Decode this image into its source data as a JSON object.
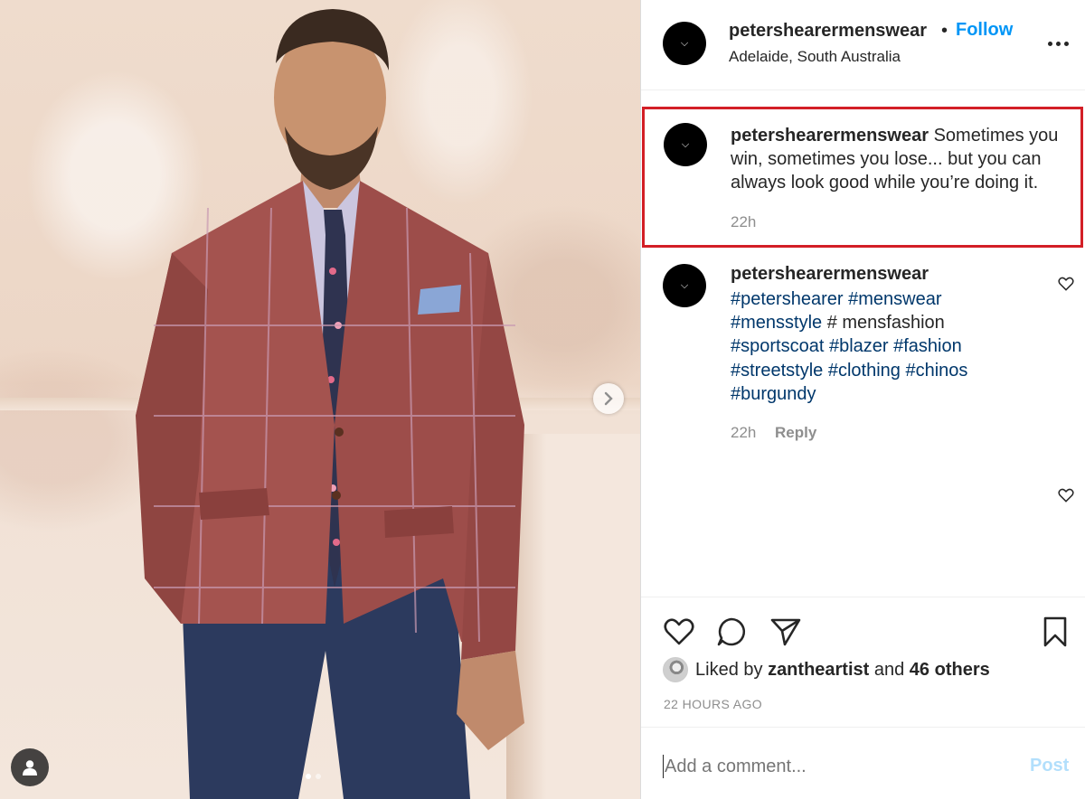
{
  "post": {
    "username": "petershearermenswear",
    "separator": "•",
    "follow_label": "Follow",
    "location": "Adelaide, South Australia",
    "more_icon": "more-horizontal-icon"
  },
  "caption": {
    "username": "petershearermenswear",
    "text": "Sometimes you win, sometimes you lose... but you can always look good while you’re doing it.",
    "time": "22h",
    "highlight_color": "#d31f26"
  },
  "comment": {
    "username": "petershearermenswear",
    "segments": [
      {
        "text": "#petershearer",
        "type": "tag"
      },
      {
        "text": " ",
        "type": "plain"
      },
      {
        "text": "#menswear",
        "type": "tag"
      },
      {
        "text": " ",
        "type": "plain"
      },
      {
        "text": "#mensstyle",
        "type": "tag"
      },
      {
        "text": " # mensfashion ",
        "type": "plain"
      },
      {
        "text": "#sportscoat",
        "type": "tag"
      },
      {
        "text": " ",
        "type": "plain"
      },
      {
        "text": "#blazer",
        "type": "tag"
      },
      {
        "text": " ",
        "type": "plain"
      },
      {
        "text": "#fashion",
        "type": "tag"
      },
      {
        "text": " ",
        "type": "plain"
      },
      {
        "text": "#streetstyle",
        "type": "tag"
      },
      {
        "text": " ",
        "type": "plain"
      },
      {
        "text": "#clothing",
        "type": "tag"
      },
      {
        "text": " ",
        "type": "plain"
      },
      {
        "text": "#chinos",
        "type": "tag"
      },
      {
        "text": " ",
        "type": "plain"
      },
      {
        "text": "#burgundy",
        "type": "tag"
      }
    ],
    "time": "22h",
    "reply_label": "Reply"
  },
  "likes": {
    "prefix": "Liked by ",
    "user": "zantheartist",
    "middle": " and ",
    "others": "46 others"
  },
  "timestamp": "22 HOURS AGO",
  "add_comment": {
    "placeholder": "Add a comment...",
    "post_label": "Post"
  },
  "carousel": {
    "slide_count": 2,
    "active_index": 0
  },
  "colors": {
    "link": "#0095f6",
    "hashtag": "#00376b",
    "muted": "#8e8e8e",
    "post_disabled": "#b2dffc"
  }
}
